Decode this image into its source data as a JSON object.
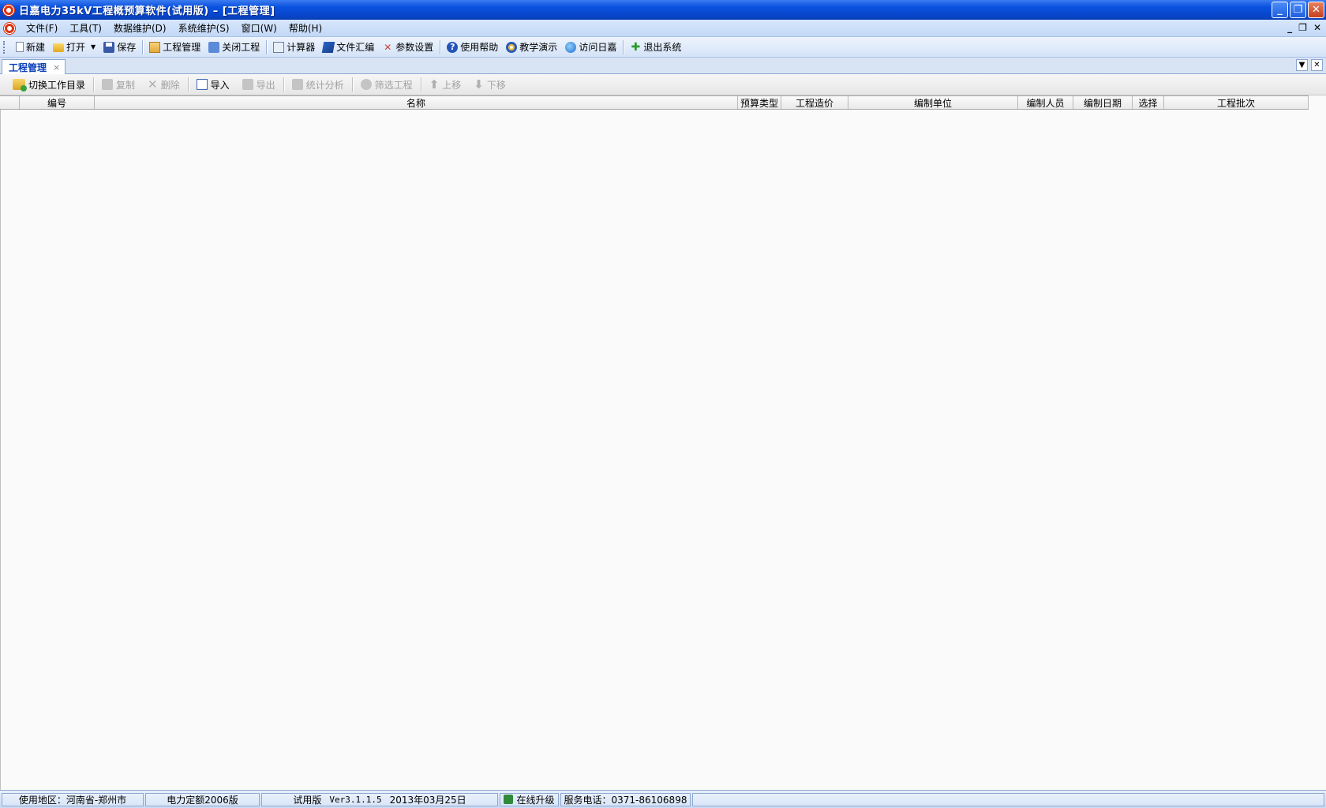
{
  "window": {
    "title": "日嘉电力35kV工程概预算软件(试用版) – [工程管理]",
    "minimize": "_",
    "restore": "❐",
    "close": "✕"
  },
  "menubar": {
    "items": [
      {
        "label": "文件(F)"
      },
      {
        "label": "工具(T)"
      },
      {
        "label": "数据维护(D)"
      },
      {
        "label": "系统维护(S)"
      },
      {
        "label": "窗口(W)"
      },
      {
        "label": "帮助(H)"
      }
    ],
    "mdi_minimize": "_",
    "mdi_restore": "❐",
    "mdi_close": "✕"
  },
  "toolbar": {
    "new": "新建",
    "open": "打开",
    "save": "保存",
    "project_manage": "工程管理",
    "close_project": "关闭工程",
    "calculator": "计算器",
    "file_compile": "文件汇编",
    "param_settings": "参数设置",
    "help": "使用帮助",
    "demo": "教学演示",
    "visit": "访问日嘉",
    "exit": "退出系统"
  },
  "tabs": {
    "active_label": "工程管理",
    "active_close": "×"
  },
  "subtoolbar": {
    "switch_dir": "切换工作目录",
    "copy": "复制",
    "delete": "删除",
    "import": "导入",
    "export": "导出",
    "stats": "统计分析",
    "filter": "筛选工程",
    "move_up": "上移",
    "move_down": "下移"
  },
  "grid": {
    "columns": [
      "",
      "编号",
      "名称",
      "预算类型",
      "工程造价",
      "编制单位",
      "编制人员",
      "编制日期",
      "选择",
      "工程批次"
    ],
    "rows": []
  },
  "status": {
    "region": "使用地区：河南省-郑州市",
    "quota": "电力定额2006版",
    "edition": "试用版",
    "version": "Ver3.1.1.5",
    "date": "2013年03月25日",
    "upgrade": "在线升级",
    "phone": "服务电话：0371-86106898"
  }
}
